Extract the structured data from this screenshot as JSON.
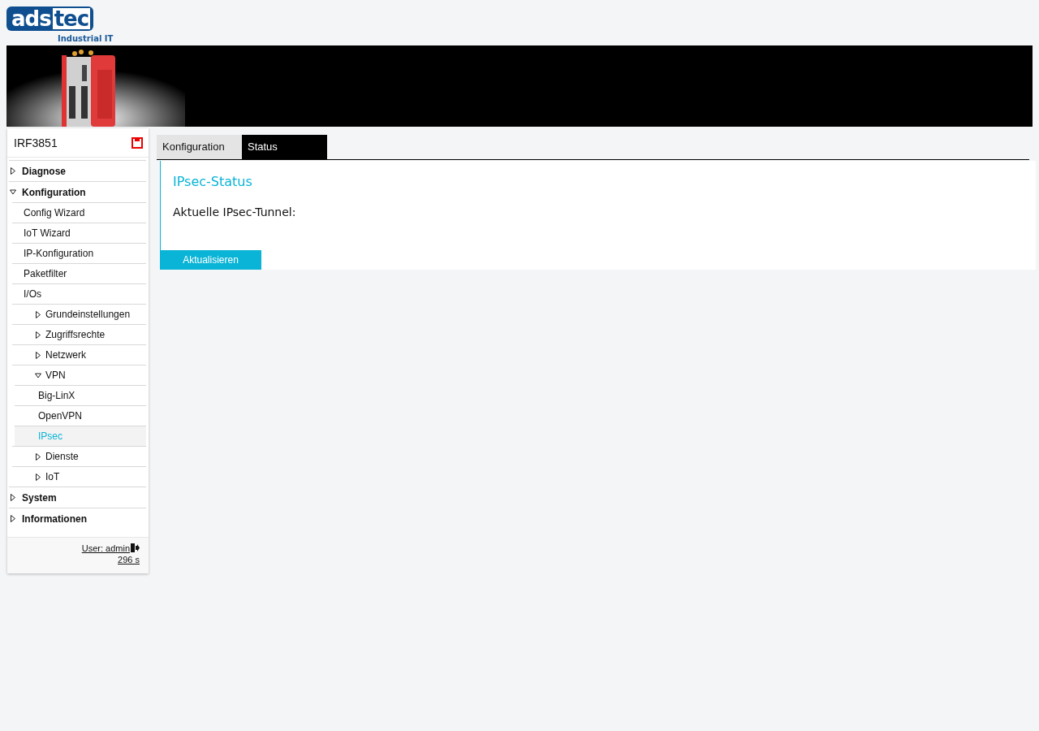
{
  "logo": {
    "left": "ads",
    "right": "tec",
    "tagline": "Industrial IT"
  },
  "sidebar": {
    "device": "IRF3851",
    "items": [
      {
        "label": "Diagnose",
        "expanded": false,
        "selected": false
      },
      {
        "label": "Konfiguration",
        "expanded": true,
        "selected": false,
        "children": [
          {
            "label": "Config Wizard",
            "selected": false
          },
          {
            "label": "IoT Wizard",
            "selected": false
          },
          {
            "label": "IP-Konfiguration",
            "selected": false
          },
          {
            "label": "Paketfilter",
            "selected": false
          },
          {
            "label": "I/Os",
            "selected": false
          },
          {
            "label": "Grundeinstellungen",
            "expanded": false,
            "selected": false
          },
          {
            "label": "Zugriffsrechte",
            "expanded": false,
            "selected": false
          },
          {
            "label": "Netzwerk",
            "expanded": false,
            "selected": false
          },
          {
            "label": "VPN",
            "expanded": true,
            "selected": false,
            "children": [
              {
                "label": "Big-LinX",
                "selected": false
              },
              {
                "label": "OpenVPN",
                "selected": false
              },
              {
                "label": "IPsec",
                "selected": true
              }
            ]
          },
          {
            "label": "Dienste",
            "expanded": false,
            "selected": false
          },
          {
            "label": "IoT",
            "expanded": false,
            "selected": false
          }
        ]
      },
      {
        "label": "System",
        "expanded": false,
        "selected": false
      },
      {
        "label": "Informationen",
        "expanded": false,
        "selected": false
      }
    ],
    "user": "User: admin",
    "timer": "296 s"
  },
  "tabs": [
    {
      "label": "Konfiguration",
      "selected": false
    },
    {
      "label": "Status",
      "selected": true
    }
  ],
  "panel": {
    "title": "IPsec-Status",
    "text": "Aktuelle IPsec-Tunnel:",
    "button": "Aktualisieren"
  }
}
